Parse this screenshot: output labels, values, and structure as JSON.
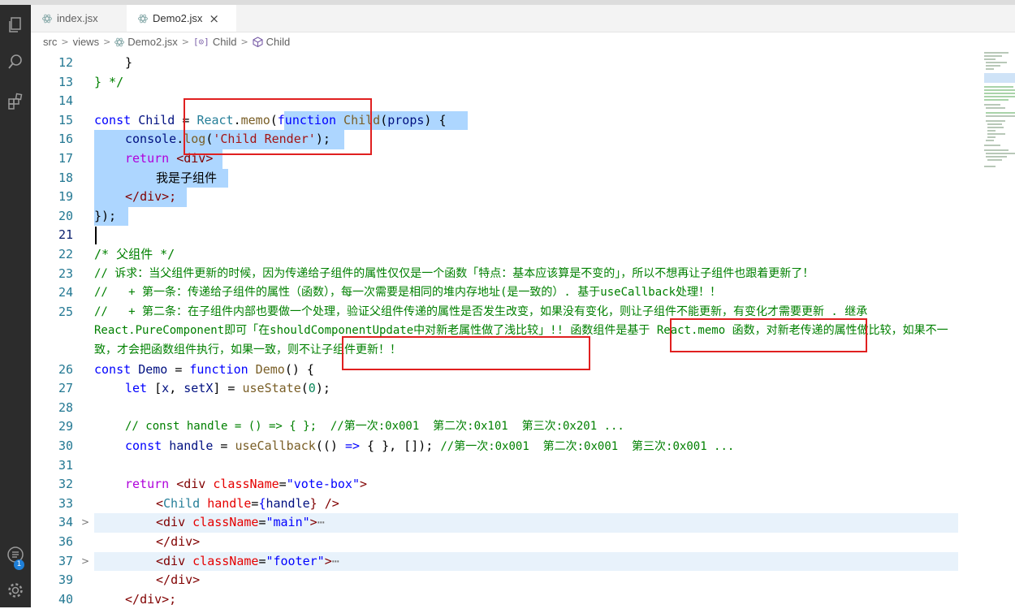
{
  "tabs": [
    {
      "label": "index.jsx",
      "active": false
    },
    {
      "label": "Demo2.jsx",
      "active": true,
      "close": "×"
    }
  ],
  "breadcrumb": [
    "src",
    "views",
    "Demo2.jsx",
    "Child",
    "Child"
  ],
  "activity_badge": "1",
  "lines": {
    "n12": "12",
    "n13": "13",
    "n14": "14",
    "n15": "15",
    "n16": "16",
    "n17": "17",
    "n18": "18",
    "n19": "19",
    "n20": "20",
    "n21": "21",
    "n22": "22",
    "n23": "23",
    "n24": "24",
    "n25": "25",
    "n26": "26",
    "n27": "27",
    "n28": "28",
    "n29": "29",
    "n30": "30",
    "n31": "31",
    "n32": "32",
    "n33": "33",
    "n34": "34",
    "n36": "36",
    "n37": "37",
    "n39": "39",
    "n40": "40"
  },
  "code": {
    "l12": "}",
    "l13": "} */",
    "l15_a": "const ",
    "l15_b": "Child",
    "l15_c": " = ",
    "l15_d": "React",
    "l15_e": ".",
    "l15_f": "memo",
    "l15_g": "(",
    "l15_h": "function",
    "l15_i": " Child",
    "l15_j": "(",
    "l15_k": "props",
    "l15_l": ") {",
    "l16_a": "console",
    "l16_b": ".",
    "l16_c": "log",
    "l16_d": "(",
    "l16_e": "'Child Render'",
    "l16_f": ");",
    "l17_a": "return ",
    "l17_b": "<",
    "l17_c": "div",
    "l17_d": ">",
    "l18": "我是子组件",
    "l19_a": "</",
    "l19_b": "div",
    "l19_c": ">;",
    "l20": "});",
    "l22": "/* 父组件 */",
    "l23": "// 诉求：当父组件更新的时候，因为传递给子组件的属性仅仅是一个函数「特点：基本应该算是不变的」，所以不想再让子组件也跟着更新了！",
    "l24": "//   + 第一条：传递给子组件的属性（函数），每一次需要是相同的堆内存地址(是一致的）. 基于useCallback处理！！",
    "l25": "//   + 第二条：在子组件内部也要做一个处理，验证父组件传递的属性是否发生改变，如果没有变化，则让子组件不能更新，有变化才需要更新 . 继承React.PureComponent即可「在shouldComponentUpdate中对新老属性做了浅比较」!! 函数组件是基于 React.memo 函数，对新老传递的属性做比较，如果不一致，才会把函数组件执行，如果一致，则不让子组件更新！！",
    "l26_a": "const ",
    "l26_b": "Demo",
    "l26_c": " = ",
    "l26_d": "function",
    "l26_e": " Demo",
    "l26_f": "() {",
    "l27_a": "let ",
    "l27_b": "[",
    "l27_c": "x",
    "l27_d": ", ",
    "l27_e": "setX",
    "l27_f": "] = ",
    "l27_g": "useState",
    "l27_h": "(",
    "l27_i": "0",
    "l27_j": ");",
    "l29": "// const handle = () => { };  //第一次:0x001  第二次:0x101  第三次:0x201 ...",
    "l30_a": "const ",
    "l30_b": "handle",
    "l30_c": " = ",
    "l30_d": "useCallback",
    "l30_e": "(() ",
    "l30_f": "=>",
    "l30_g": " { }, []); ",
    "l30_h": "//第一次:0x001  第二次:0x001  第三次:0x001 ...",
    "l32_a": "return ",
    "l32_b": "<",
    "l32_c": "div",
    "l32_d": " className",
    "l32_e": "=",
    "l32_f": "\"vote-box\"",
    "l32_g": ">",
    "l33_a": "<",
    "l33_b": "Child",
    "l33_c": " handle",
    "l33_d": "=",
    "l33_e": "{",
    "l33_f": "handle",
    "l33_g": "} />",
    "l34_a": "<",
    "l34_b": "div",
    "l34_c": " className",
    "l34_d": "=",
    "l34_e": "\"main\"",
    "l34_f": ">",
    "l34_g": "⋯",
    "l36_a": "</",
    "l36_b": "div",
    "l36_c": ">",
    "l37_a": "<",
    "l37_b": "div",
    "l37_c": " className",
    "l37_d": "=",
    "l37_e": "\"footer\"",
    "l37_f": ">",
    "l37_g": "⋯",
    "l39_a": "</",
    "l39_b": "div",
    "l39_c": ">",
    "l40_a": "</",
    "l40_b": "div",
    "l40_c": ">;"
  },
  "colors": {
    "keyword": "#0000ff",
    "comment": "#008000",
    "string": "#a31515",
    "annotation_box": "#e02020",
    "selection": "#add6ff"
  }
}
